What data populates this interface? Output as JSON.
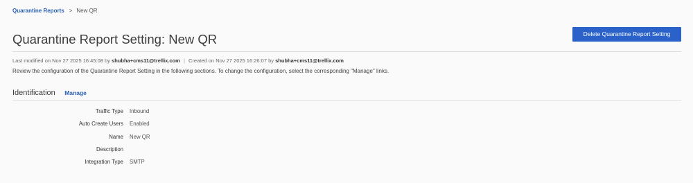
{
  "breadcrumb": {
    "parent": "Quarantine Reports",
    "separator": ">",
    "current": "New QR"
  },
  "page_title": "Quarantine Report Setting: New QR",
  "actions": {
    "delete_label": "Delete Quarantine Report Setting"
  },
  "meta": {
    "modified_prefix": "Last modified on Nov 27 2025 16:45:08 by",
    "modified_by": "shubha+cms11@trellix.com",
    "divider": "|",
    "created_prefix": "Created on Nov 27 2025 16:26:07 by",
    "created_by": "shubha+cms11@trellix.com"
  },
  "description": "Review the configuration of the Quarantine Report Setting in the following sections. To change the configuration, select the corresponding \"Manage\" links.",
  "identification": {
    "title": "Identification",
    "manage_label": "Manage",
    "fields": [
      {
        "label": "Traffic Type",
        "value": "Inbound"
      },
      {
        "label": "Auto Create Users",
        "value": "Enabled"
      },
      {
        "label": "Name",
        "value": "New QR"
      },
      {
        "label": "Description",
        "value": ""
      },
      {
        "label": "Integration Type",
        "value": "SMTP"
      }
    ]
  },
  "colors": {
    "accent": "#2b62c9",
    "link": "#2a5fb0",
    "background": "#fafafa"
  }
}
